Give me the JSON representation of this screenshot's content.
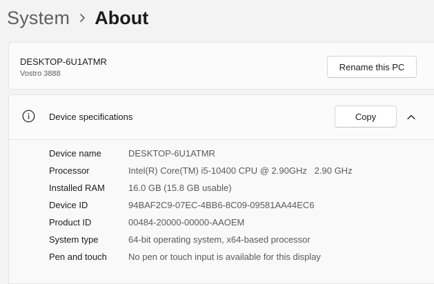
{
  "breadcrumb": {
    "parent": "System",
    "current": "About"
  },
  "device_card": {
    "pc_name": "DESKTOP-6U1ATMR",
    "model": "Vostro 3888",
    "rename_label": "Rename this PC"
  },
  "specs": {
    "title": "Device specifications",
    "copy_label": "Copy",
    "rows": [
      {
        "label": "Device name",
        "value": "DESKTOP-6U1ATMR"
      },
      {
        "label": "Processor",
        "value": "Intel(R) Core(TM) i5-10400 CPU @ 2.90GHz   2.90 GHz"
      },
      {
        "label": "Installed RAM",
        "value": "16.0 GB (15.8 GB usable)"
      },
      {
        "label": "Device ID",
        "value": "94BAF2C9-07EC-4BB6-8C09-09581AA44EC6"
      },
      {
        "label": "Product ID",
        "value": "00484-20000-00000-AAOEM"
      },
      {
        "label": "System type",
        "value": "64-bit operating system, x64-based processor"
      },
      {
        "label": "Pen and touch",
        "value": "No pen or touch input is available for this display"
      }
    ]
  },
  "icons": {
    "breadcrumb_separator": "chevron-right-icon",
    "specs_icon": "info-icon",
    "collapse": "chevron-up-icon"
  }
}
